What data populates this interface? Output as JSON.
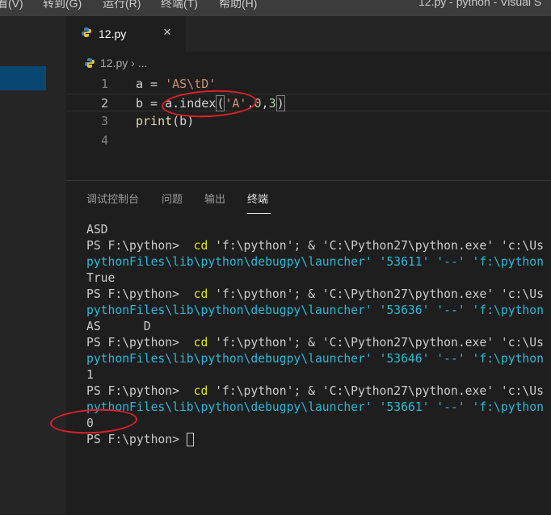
{
  "menubar": {
    "items": [
      {
        "label": "看(V)"
      },
      {
        "label": "转到(G)"
      },
      {
        "label": "运行(R)"
      },
      {
        "label": "终端(T)"
      },
      {
        "label": "帮助(H)"
      }
    ],
    "window_title": "12.py - python - Visual S"
  },
  "tab": {
    "label": "12.py",
    "close_icon": "×"
  },
  "breadcrumb": {
    "file": "12.py",
    "separator": "›",
    "more": "..."
  },
  "code_lines": [
    {
      "num": "1",
      "p1": "a = ",
      "s1": "'AS\\tD'"
    },
    {
      "num": "2",
      "p1": "b = a.index",
      "ob": "(",
      "s1": "'A'",
      "p2": ",",
      "n1": "0",
      "p3": ",",
      "n2": "3",
      "cb": ")"
    },
    {
      "num": "3",
      "fn": "print",
      "p1": "(b)"
    },
    {
      "num": "4"
    }
  ],
  "panel_tabs": [
    {
      "label": "调试控制台"
    },
    {
      "label": "问题"
    },
    {
      "label": "输出"
    },
    {
      "label": "终端"
    }
  ],
  "terminal": {
    "outputs": [
      "ASD",
      "True",
      "AS      D",
      "1",
      "0"
    ],
    "prompt": "PS F:\\python> ",
    "cmd_cd": "cd",
    "cmd_rest": " 'f:\\python'; & 'C:\\Python27\\python.exe' 'c:\\Us",
    "cont_prefix": "pythonFiles\\lib\\python\\debugpy\\launcher' ",
    "ports": [
      "'53611'",
      "'53636'",
      "'53646'",
      "'53661'"
    ],
    "cont_suffix": " '--' 'f:\\python",
    "final_prompt": "PS F:\\python> "
  },
  "colors": {
    "accent_selection": "#094771",
    "annotation_red": "#e0202a",
    "terminal_yellow": "#e5e510",
    "terminal_cyan": "#29b8db"
  },
  "icons": {
    "tab_icon": "python-file-icon",
    "breadcrumb_icon": "python-file-icon",
    "tab_close": "close-icon"
  }
}
